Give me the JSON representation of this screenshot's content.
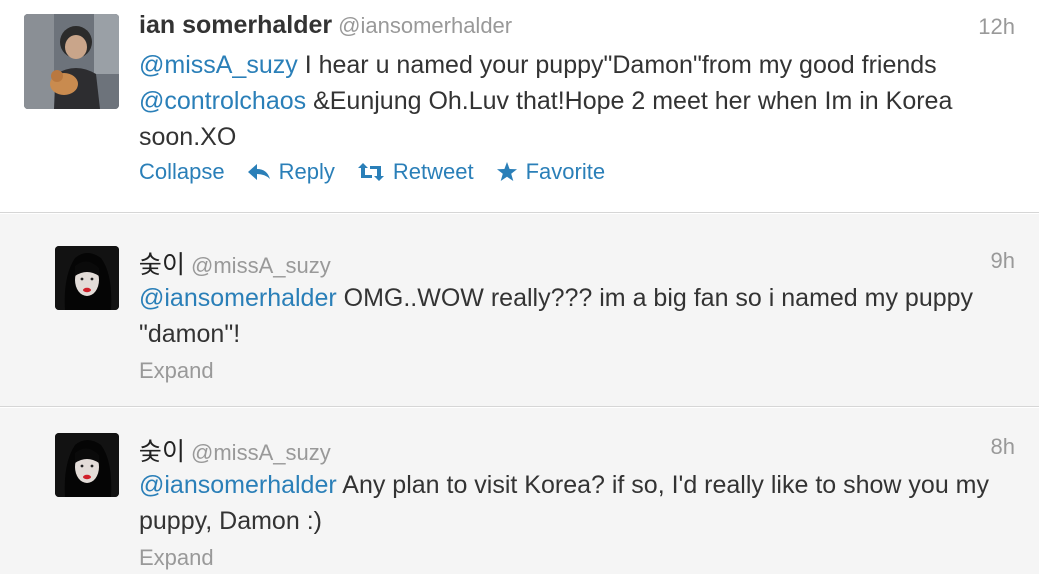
{
  "tweets": [
    {
      "fullname": "ian somerhalder",
      "handle": "@iansomerhalder",
      "time": "12h",
      "text_parts": [
        {
          "type": "mention",
          "text": "@missA_suzy"
        },
        {
          "type": "text",
          "text": " I hear u named your puppy\"Damon\"from my good friends "
        },
        {
          "type": "mention",
          "text": "@controlchaos"
        },
        {
          "type": "text",
          "text": " &Eunjung Oh.Luv that!Hope 2 meet her when Im in Korea soon.XO"
        }
      ],
      "actions": {
        "collapse": "Collapse",
        "reply": "Reply",
        "retweet": "Retweet",
        "favorite": "Favorite"
      }
    },
    {
      "fullname": "숮이",
      "handle": "@missA_suzy",
      "time": "9h",
      "text_parts": [
        {
          "type": "mention",
          "text": "@iansomerhalder"
        },
        {
          "type": "text",
          "text": " OMG..WOW really??? im a big fan so i named my puppy \"damon\"!"
        }
      ],
      "expand": "Expand"
    },
    {
      "fullname": "숮이",
      "handle": "@missA_suzy",
      "time": "8h",
      "text_parts": [
        {
          "type": "mention",
          "text": "@iansomerhalder"
        },
        {
          "type": "text",
          "text": " Any plan to visit Korea? if so, I'd really like to show you my puppy, Damon :)"
        }
      ],
      "expand": "Expand"
    }
  ],
  "colors": {
    "link": "#2a7fb8",
    "muted": "#999999",
    "text": "#333333",
    "reply_background": "#f5f5f5",
    "divider": "#d6d6d6"
  },
  "icons": {
    "reply": "reply-arrow-icon",
    "retweet": "retweet-icon",
    "favorite": "star-icon"
  }
}
